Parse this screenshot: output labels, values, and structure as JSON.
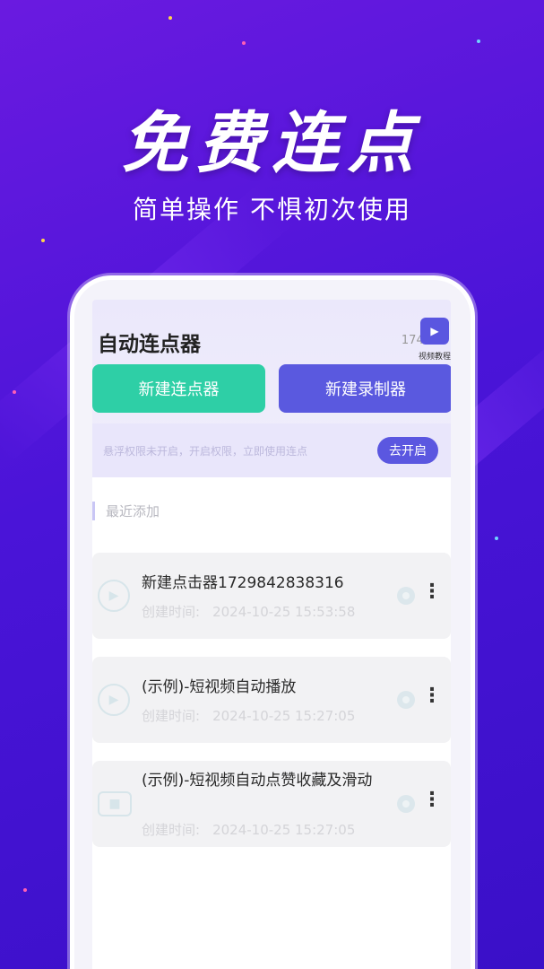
{
  "promo": {
    "headline": "免费连点",
    "subhead": "简单操作 不惧初次使用"
  },
  "app": {
    "title": "自动连点器",
    "counter": "1748",
    "corner_label": "视频教程",
    "corner_icon": "video-tutorial-icon"
  },
  "actions": {
    "new_clicker": "新建连点器",
    "new_recorder": "新建录制器"
  },
  "notice": {
    "text": "悬浮权限未开启，开启权限，立即使用连点",
    "button": "去开启"
  },
  "section": {
    "recent": "最近添加"
  },
  "items": [
    {
      "name": "新建点击器1729842838316",
      "created_label": "创建时间:",
      "created_time": "2024-10-25 15:53:58",
      "icon": "play-icon"
    },
    {
      "name": "(示例)-短视频自动播放",
      "created_label": "创建时间:",
      "created_time": "2024-10-25 15:27:05",
      "icon": "play-icon"
    },
    {
      "name": "(示例)-短视频自动点赞收藏及滑动",
      "created_label": "创建时间:",
      "created_time": "2024-10-25 15:27:05",
      "icon": "video-camera-icon"
    }
  ],
  "colors": {
    "green": "#2ecfa6",
    "purple": "#5a59df",
    "background": "#4a14d8"
  }
}
